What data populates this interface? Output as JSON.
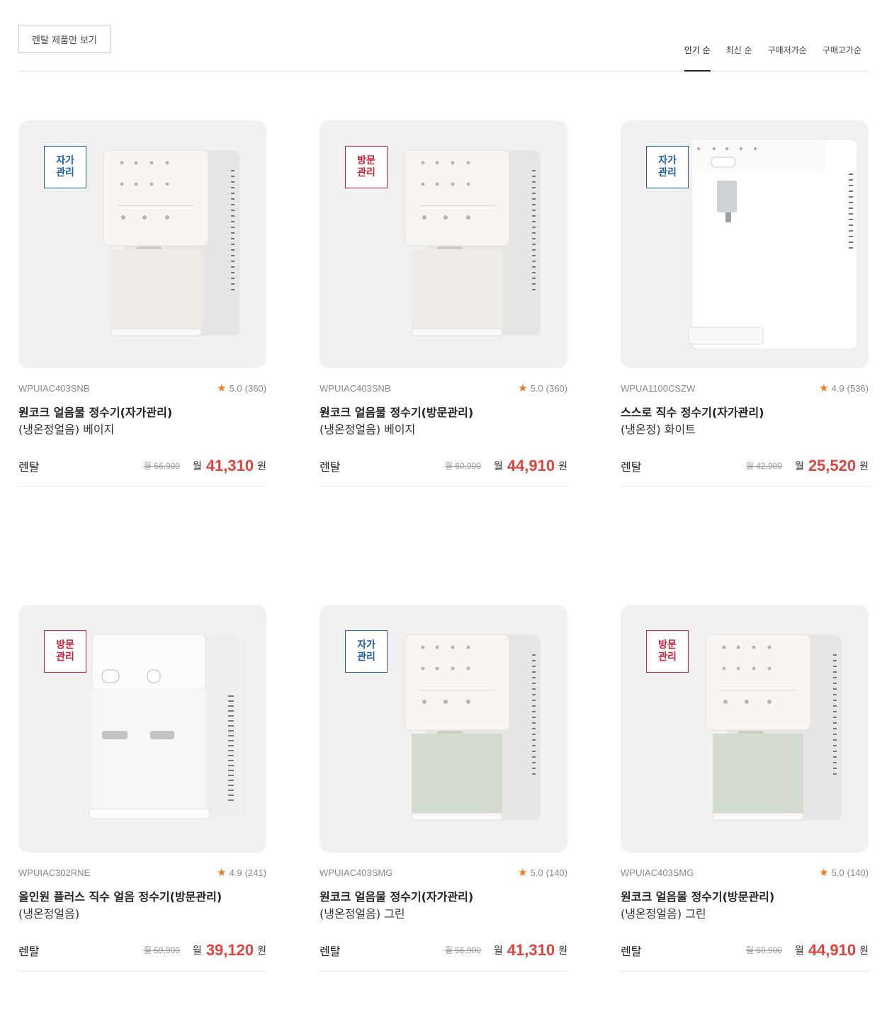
{
  "toolbar": {
    "rental_filter": "렌탈 제품만 보기",
    "sort_tabs": [
      "인기 순",
      "최신 순",
      "구매저가순",
      "구매고가순"
    ]
  },
  "products": [
    {
      "badge": "자가\n관리",
      "badge_line1": "자가",
      "badge_line2": "관리",
      "badge_type": "self",
      "model": "WPUIAC403SNB",
      "rating": "5.0",
      "reviews": "(360)",
      "name": "원코크 얼음물 정수기(자가관리)",
      "spec": "(냉온정얼음) 베이지",
      "rent_label": "렌탈",
      "orig_price": "월 56,900",
      "month": "월",
      "price": "41,310",
      "won": "원",
      "front_color": "#efebe7"
    },
    {
      "badge_line1": "방문",
      "badge_line2": "관리",
      "badge_type": "visit",
      "model": "WPUIAC403SNB",
      "rating": "5.0",
      "reviews": "(360)",
      "name": "원코크 얼음물 정수기(방문관리)",
      "spec": "(냉온정얼음) 베이지",
      "rent_label": "렌탈",
      "orig_price": "월 60,900",
      "month": "월",
      "price": "44,910",
      "won": "원",
      "front_color": "#efebe7"
    },
    {
      "badge_line1": "자가",
      "badge_line2": "관리",
      "badge_type": "self",
      "model": "WPUA1100CSZW",
      "rating": "4.9",
      "reviews": "(536)",
      "name": "스스로 직수 정수기(자가관리)",
      "spec": "(냉온정) 화이트",
      "rent_label": "렌탈",
      "orig_price": "월 42,900",
      "month": "월",
      "price": "25,520",
      "won": "원",
      "front_color": "#ffffff"
    },
    {
      "badge_line1": "방문",
      "badge_line2": "관리",
      "badge_type": "visit",
      "model": "WPUIAC302RNE",
      "rating": "4.9",
      "reviews": "(241)",
      "name": "올인원 플러스 직수 얼음 정수기(방문관리)",
      "spec": "(냉온정얼음)",
      "rent_label": "렌탈",
      "orig_price": "월 59,900",
      "month": "월",
      "price": "39,120",
      "won": "원",
      "front_color": "#f6f5f4"
    },
    {
      "badge_line1": "자가",
      "badge_line2": "관리",
      "badge_type": "self",
      "model": "WPUIAC403SMG",
      "rating": "5.0",
      "reviews": "(140)",
      "name": "원코크 얼음물 정수기(자가관리)",
      "spec": "(냉온정얼음) 그린",
      "rent_label": "렌탈",
      "orig_price": "월 56,900",
      "month": "월",
      "price": "41,310",
      "won": "원",
      "front_color": "#d3dbd0"
    },
    {
      "badge_line1": "방문",
      "badge_line2": "관리",
      "badge_type": "visit",
      "model": "WPUIAC403SMG",
      "rating": "5.0",
      "reviews": "(140)",
      "name": "원코크 얼음물 정수기(방문관리)",
      "spec": "(냉온정얼음) 그린",
      "rent_label": "렌탈",
      "orig_price": "월 60,900",
      "month": "월",
      "price": "44,910",
      "won": "원",
      "front_color": "#d3dbd0"
    }
  ]
}
